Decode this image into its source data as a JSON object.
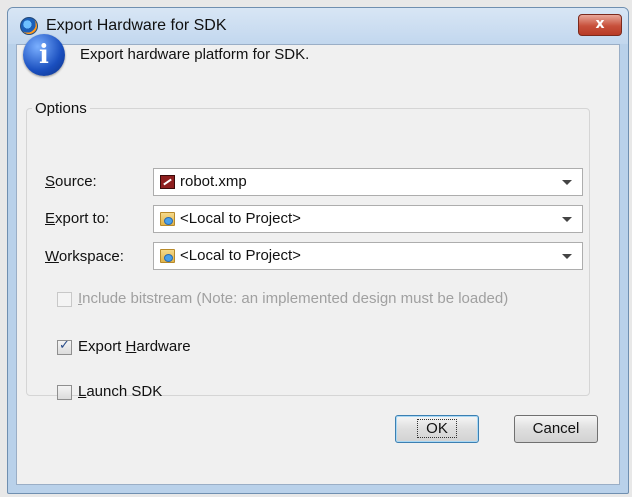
{
  "window": {
    "title": "Export Hardware for SDK",
    "close_label": "x"
  },
  "info": {
    "icon": "info-icon",
    "message": "Export hardware platform for SDK."
  },
  "options": {
    "legend": "Options",
    "source": {
      "label": "Source:",
      "mnemonic": "S",
      "label_rest": "ource:",
      "value": "robot.xmp",
      "icon": "xmp-file-icon"
    },
    "export_to": {
      "label": "Export to:",
      "mnemonic": "E",
      "label_rest": "xport to:",
      "value": "<Local to Project>",
      "icon": "folder-icon"
    },
    "workspace": {
      "label": "Workspace:",
      "mnemonic": "W",
      "label_rest": "orkspace:",
      "value": "<Local to Project>",
      "icon": "folder-icon"
    },
    "include_bitstream": {
      "pre": "",
      "mnemonic": "I",
      "rest": "nclude bitstream (Note: an implemented design must be loaded)",
      "checked": false,
      "enabled": false
    },
    "export_hardware": {
      "pre": "Export ",
      "mnemonic": "H",
      "rest": "ardware",
      "checked": true,
      "enabled": true
    },
    "launch_sdk": {
      "pre": "",
      "mnemonic": "L",
      "rest": "aunch SDK",
      "checked": false,
      "enabled": true
    }
  },
  "buttons": {
    "ok": "OK",
    "cancel": "Cancel"
  }
}
